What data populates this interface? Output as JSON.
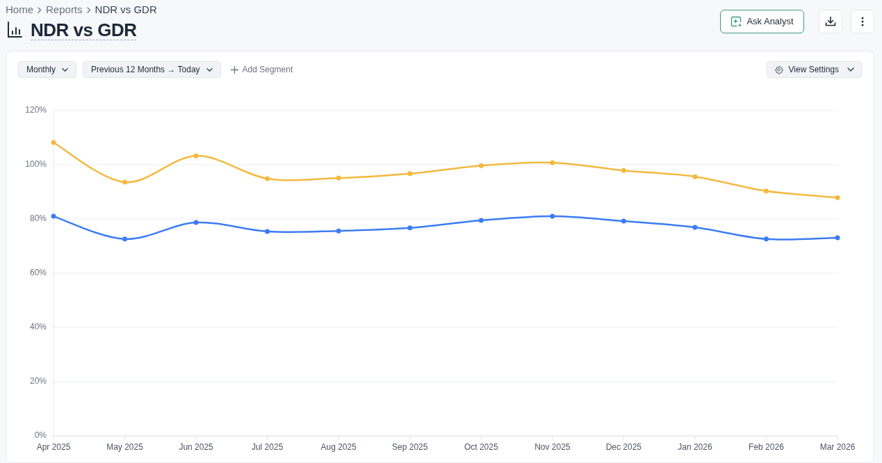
{
  "breadcrumb": [
    {
      "label": "Home",
      "current": false
    },
    {
      "label": "Reports",
      "current": false
    },
    {
      "label": "NDR vs GDR",
      "current": true
    }
  ],
  "title": "NDR vs GDR",
  "actions": [
    {
      "kind": "ai",
      "label": "Ask Analyst"
    },
    {
      "kind": "download"
    },
    {
      "kind": "more"
    }
  ],
  "report": {
    "filters": [
      {
        "kind": "dropdown",
        "value": "Monthly"
      },
      {
        "kind": "dropdown",
        "value": "Previous 12 Months → Today"
      },
      {
        "kind": "add",
        "label": "Add Segment"
      }
    ],
    "view_settings": {
      "label": "View Settings"
    },
    "chart_data": [
      {
        "type": "line",
        "marker": "circle",
        "grid": "y",
        "categories": [
          "Apr 2025",
          "May 2025",
          "Jun 2025",
          "Jul 2025",
          "Aug 2025",
          "Sep 2025",
          "Oct 2025",
          "Nov 2025",
          "Dec 2025",
          "Jan 2026",
          "Feb 2026",
          "Mar 2026"
        ],
        "ylim": [
          0,
          120
        ],
        "yticks": [
          {
            "value": 0,
            "label": "0%"
          },
          {
            "value": 20,
            "label": "20%"
          },
          {
            "value": 40,
            "label": "40%"
          },
          {
            "value": 60,
            "label": "60%"
          },
          {
            "value": 80,
            "label": "80%"
          },
          {
            "value": 100,
            "label": "100%"
          },
          {
            "value": 120,
            "label": "120%"
          }
        ],
        "series": [
          {
            "color": "#f3b93f",
            "values": [
              108.2,
              93.6,
              103.3,
              94.9,
              95.1,
              96.7,
              99.7,
              100.8,
              97.9,
              95.6,
              90.3,
              87.9
            ]
          },
          {
            "color": "#3c7cf5",
            "values": [
              81.0,
              72.6,
              78.7,
              75.4,
              75.6,
              76.7,
              79.5,
              81.0,
              79.2,
              76.9,
              72.6,
              73.1
            ]
          }
        ]
      }
    ]
  }
}
